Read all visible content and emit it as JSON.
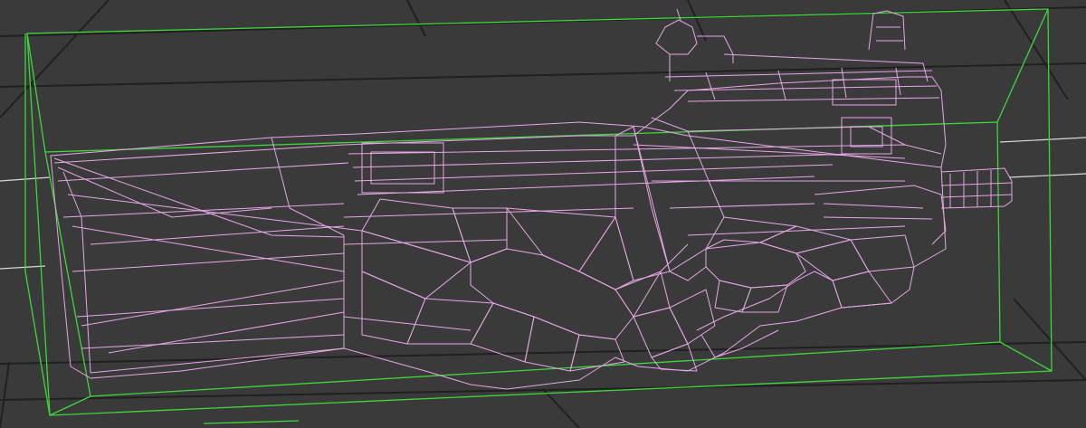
{
  "viewport": {
    "view": "perspective",
    "shading_mode": "wireframe",
    "background_color": "#3a3a3a",
    "grid_color": "#202020",
    "grid_axis_color": "#d8d8d8",
    "wireframe_color": "#e6a7e6",
    "bounding_box_color": "#3cd83c"
  }
}
